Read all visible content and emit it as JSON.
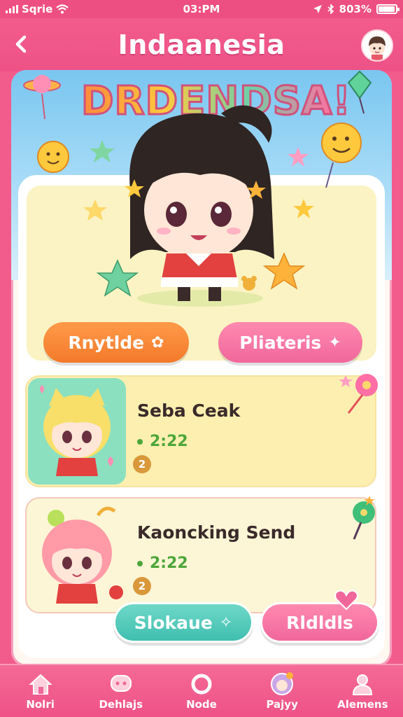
{
  "status_bar": {
    "carrier": "Sqrie",
    "time": "03:PM",
    "battery_label": "803%",
    "battery_level": 0.95
  },
  "header": {
    "title": "Indaanesia",
    "back_icon": "chevron-left-icon",
    "avatar_icon": "user-avatar-icon"
  },
  "hero": {
    "banner": "DRDENDSA!",
    "buttons": [
      {
        "label": "Rnytlde",
        "icon": "palette-icon"
      },
      {
        "label": "Pliateris",
        "icon": "gift-icon"
      }
    ]
  },
  "list": [
    {
      "title": "Seba Ceak",
      "time": "2:22",
      "coin": "2"
    },
    {
      "title": "Kaoncking Send",
      "time": "2:22",
      "coin": "2"
    }
  ],
  "actions": [
    {
      "label": "Slokaue",
      "icon": "sticker-icon"
    },
    {
      "label": "Rldldls",
      "icon": "heart-icon"
    }
  ],
  "tabs": [
    {
      "label": "Nolri",
      "icon": "home-icon"
    },
    {
      "label": "Dehlajs",
      "icon": "chat-icon"
    },
    {
      "label": "Node",
      "icon": "ring-icon"
    },
    {
      "label": "Pajyy",
      "icon": "profile-icon"
    },
    {
      "label": "Alemens",
      "icon": "person-icon"
    }
  ],
  "colors": {
    "primary": "#f25c8c",
    "orange": "#f27a2a",
    "teal": "#3fbfb0",
    "card_yellow": "#fcefb0",
    "time_green": "#4ea63a"
  }
}
